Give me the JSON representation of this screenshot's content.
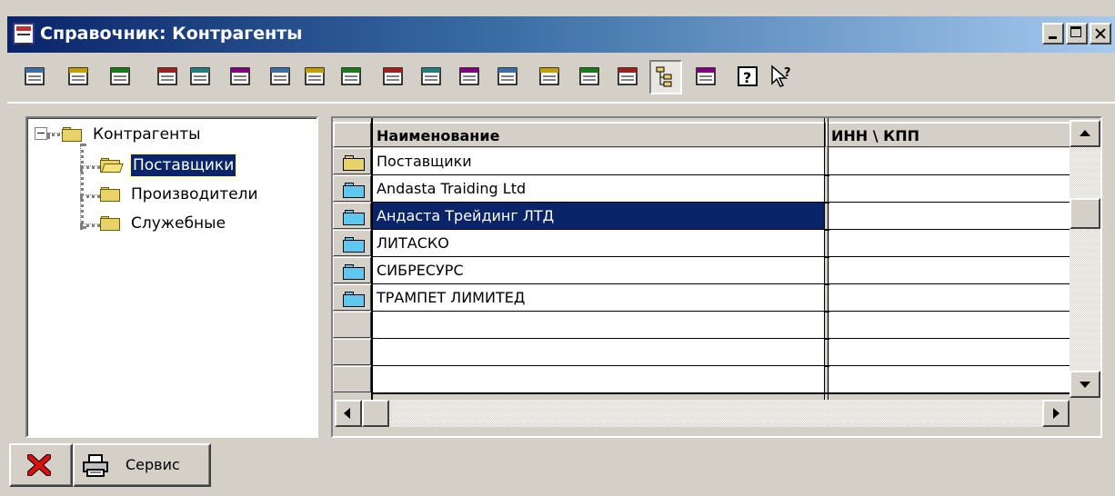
{
  "window": {
    "title": "Справочник: Контрагенты",
    "controls": [
      "minimize-icon",
      "maximize-icon",
      "close-icon"
    ]
  },
  "toolbar": {
    "buttons": [
      {
        "icon": "new-item-icon",
        "pressed": false
      },
      {
        "icon": "new-group-icon",
        "pressed": false
      },
      {
        "icon": "edit-icon",
        "pressed": false
      },
      {
        "icon": "find-icon",
        "pressed": false
      },
      {
        "icon": "add-row-icon",
        "pressed": false
      },
      {
        "icon": "delete-row-icon",
        "pressed": false
      },
      {
        "icon": "copy-row-icon",
        "pressed": false
      },
      {
        "icon": "move-to-group-icon",
        "pressed": false
      },
      {
        "icon": "level-down-icon",
        "pressed": false
      },
      {
        "icon": "filter-icon",
        "pressed": false
      },
      {
        "icon": "sort-icon",
        "pressed": false
      },
      {
        "icon": "move-icon",
        "pressed": false
      },
      {
        "icon": "mark-icon",
        "pressed": false
      },
      {
        "icon": "copy-icon",
        "pressed": false
      },
      {
        "icon": "properties-icon",
        "pressed": false
      },
      {
        "icon": "refresh-icon",
        "pressed": false
      },
      {
        "icon": "tree-view-icon",
        "pressed": true
      },
      {
        "icon": "list-view-icon",
        "pressed": false
      },
      {
        "icon": "help-icon",
        "pressed": false
      },
      {
        "icon": "context-help-icon",
        "pressed": false
      }
    ]
  },
  "tree": {
    "root": "Контрагенты",
    "children": [
      {
        "label": "Поставщики",
        "selected": true
      },
      {
        "label": "Производители",
        "selected": false
      },
      {
        "label": "Служебные",
        "selected": false
      }
    ]
  },
  "grid": {
    "columns": [
      "Наименование",
      "ИНН \\ КПП"
    ],
    "rows": [
      {
        "name": "Поставщики",
        "inn": "",
        "is_group": true,
        "selected": false
      },
      {
        "name": "Andasta Traiding Ltd",
        "inn": "",
        "is_group": false,
        "selected": false
      },
      {
        "name": "Андаста Трейдинг ЛТД",
        "inn": "",
        "is_group": false,
        "selected": true
      },
      {
        "name": "ЛИТАСКО",
        "inn": "",
        "is_group": false,
        "selected": false
      },
      {
        "name": "СИБРЕСУРС",
        "inn": "",
        "is_group": false,
        "selected": false
      },
      {
        "name": "ТРАМПЕТ ЛИМИТЕД",
        "inn": "",
        "is_group": false,
        "selected": false
      },
      {
        "name": "",
        "inn": "",
        "is_group": false,
        "selected": false
      },
      {
        "name": "",
        "inn": "",
        "is_group": false,
        "selected": false
      },
      {
        "name": "",
        "inn": "",
        "is_group": false,
        "selected": false
      }
    ]
  },
  "bottom": {
    "close_icon": "red-x-icon",
    "service_icon": "printer-icon",
    "service_label": "Сервис"
  },
  "colors": {
    "title_start": "#0a246a",
    "title_end": "#a6caf0",
    "selection": "#0a246a",
    "face": "#d4d0c8",
    "folder": "#e8d26a",
    "grid_folder": "#5fc8f0"
  }
}
